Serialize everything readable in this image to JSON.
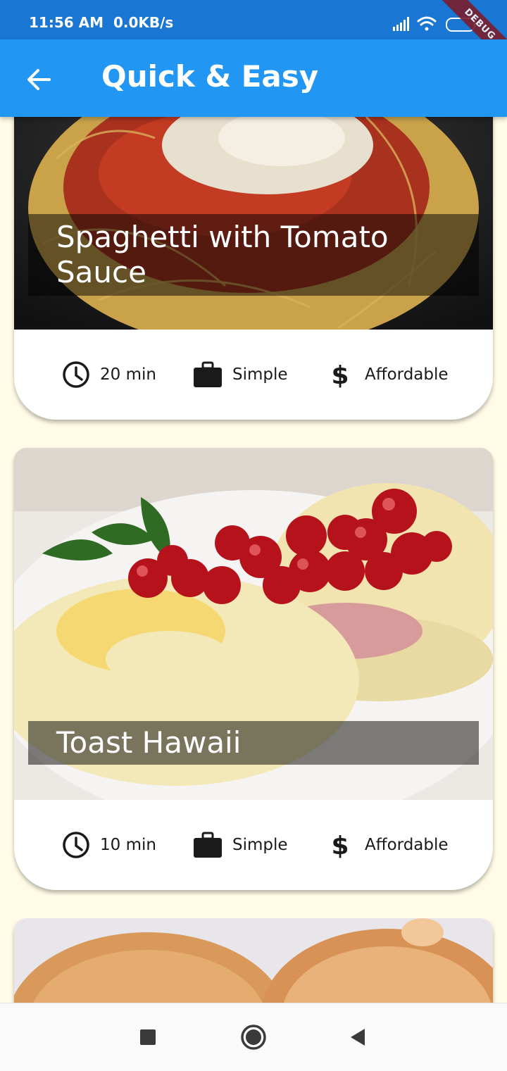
{
  "status_bar": {
    "time": "11:56 AM",
    "speed": "0.0KB/s",
    "debug_label": "DEBUG"
  },
  "app_bar": {
    "title": "Quick & Easy",
    "back_icon": "arrow-back-icon"
  },
  "meals": [
    {
      "title": "Spaghetti with Tomato Sauce",
      "duration": "20 min",
      "complexity": "Simple",
      "affordability": "Affordable"
    },
    {
      "title": "Toast Hawaii",
      "duration": "10 min",
      "complexity": "Simple",
      "affordability": "Affordable"
    },
    {
      "title": "",
      "duration": "",
      "complexity": "",
      "affordability": ""
    }
  ],
  "icons": {
    "duration": "clock-icon",
    "complexity": "briefcase-icon",
    "affordability": "dollar-icon"
  },
  "nav_bar": [
    "recent-apps-icon",
    "home-icon",
    "back-icon"
  ],
  "colors": {
    "status_bar": "#1976d2",
    "app_bar": "#2196f3",
    "background": "#fffbe6"
  }
}
